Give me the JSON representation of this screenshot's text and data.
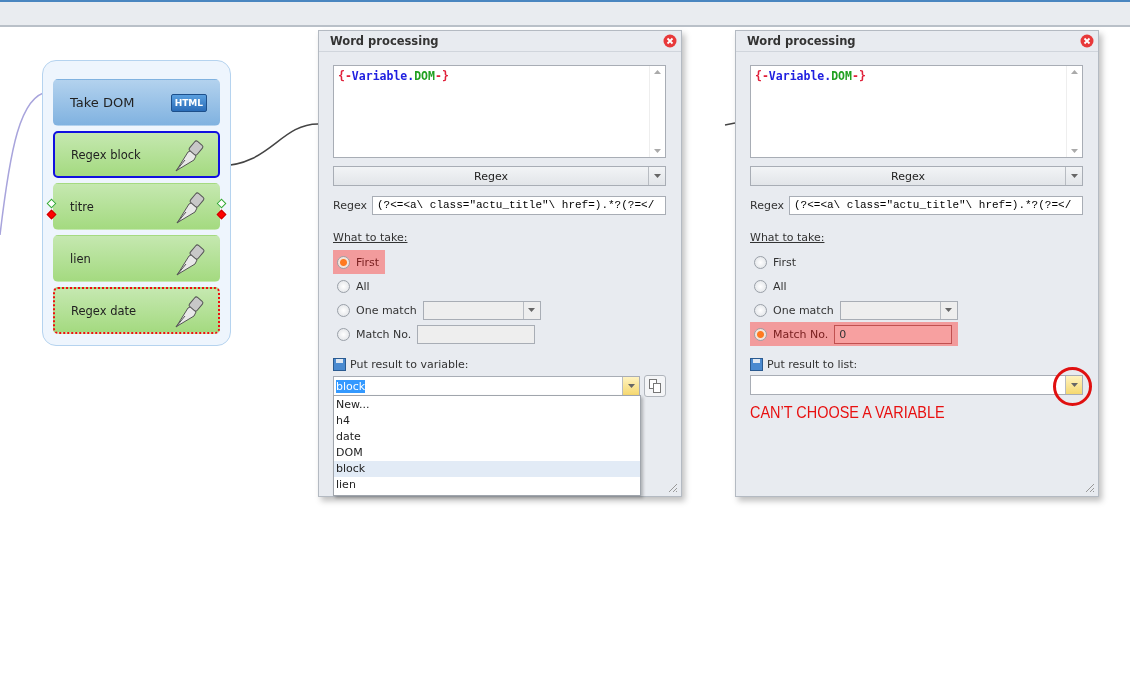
{
  "nodes": [
    {
      "label": "Take DOM",
      "kind": "html",
      "badge": "HTML",
      "selected": false,
      "flagged": false,
      "ports": false
    },
    {
      "label": "Regex block",
      "kind": "regex",
      "selected": true,
      "flagged": false,
      "ports": false
    },
    {
      "label": "titre",
      "kind": "regex",
      "selected": false,
      "flagged": false,
      "ports": true
    },
    {
      "label": "lien",
      "kind": "regex",
      "selected": false,
      "flagged": false,
      "ports": false
    },
    {
      "label": "Regex date",
      "kind": "regex",
      "selected": false,
      "flagged": true,
      "ports": false
    }
  ],
  "dialogs": [
    {
      "title": "Word processing",
      "input_text": [
        {
          "text": "{-",
          "color": "#e0203a"
        },
        {
          "text": "Variable.",
          "color": "#2020e0"
        },
        {
          "text": "DOM",
          "color": "#20a020"
        },
        {
          "text": "-}",
          "color": "#e0203a"
        }
      ],
      "mode": "Regex",
      "regex_label": "Regex",
      "regex_value": "(?<=<a\\ class=\"actu_title\"\\ href=).*?(?=</",
      "take_label": "What to take:",
      "options": [
        {
          "label": "First",
          "kind": "plain",
          "selected": true,
          "highlighted": true
        },
        {
          "label": "All",
          "kind": "plain",
          "selected": false,
          "highlighted": false
        },
        {
          "label": "One match",
          "kind": "combo",
          "selected": false,
          "highlighted": false
        },
        {
          "label": "Match No.",
          "kind": "input",
          "selected": false,
          "highlighted": false
        }
      ],
      "output_label": "Put result to variable:",
      "output_value": "block",
      "output_selected": true,
      "circled": false,
      "dropdown": [
        {
          "label": "New...",
          "selected": false
        },
        {
          "label": "h4",
          "selected": false
        },
        {
          "label": "date",
          "selected": false
        },
        {
          "label": "DOM",
          "selected": false
        },
        {
          "label": "block",
          "selected": true
        },
        {
          "label": "lien",
          "selected": false
        }
      ]
    },
    {
      "title": "Word processing",
      "input_text": [
        {
          "text": "{-",
          "color": "#e0203a"
        },
        {
          "text": "Variable.",
          "color": "#2020e0"
        },
        {
          "text": "DOM",
          "color": "#20a020"
        },
        {
          "text": "-}",
          "color": "#e0203a"
        }
      ],
      "mode": "Regex",
      "regex_label": "Regex",
      "regex_value": "(?<=<a\\ class=\"actu_title\"\\ href=).*?(?=</",
      "take_label": "What to take:",
      "options": [
        {
          "label": "First",
          "kind": "plain",
          "selected": false,
          "highlighted": false
        },
        {
          "label": "All",
          "kind": "plain",
          "selected": false,
          "highlighted": false
        },
        {
          "label": "One match",
          "kind": "combo",
          "selected": false,
          "highlighted": false
        },
        {
          "label": "Match No.",
          "kind": "input",
          "value": "0",
          "selected": true,
          "highlighted": true
        }
      ],
      "output_label": "Put result to list:",
      "circled": true,
      "annotation": "CAN’T CHOOSE A VARIABLE"
    }
  ]
}
